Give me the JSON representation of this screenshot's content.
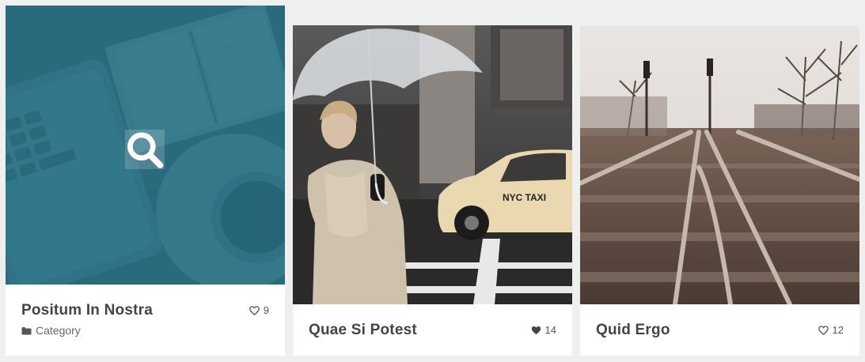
{
  "colors": {
    "page_background": "#efefef",
    "card_background": "#ffffff",
    "hover_overlay": "#2e6e80",
    "title_text": "#444444",
    "meta_text": "#666666"
  },
  "items": [
    {
      "title": "Positum In Nostra",
      "likes": "9",
      "liked": false,
      "category": "Category",
      "hovered": true,
      "image": "desk-laptop-notebook-coffee",
      "zoom_icon": "search-icon",
      "category_icon": "folder-icon",
      "like_icon": "heart-outline-icon"
    },
    {
      "title": "Quae Si Potest",
      "likes": "14",
      "liked": true,
      "image": "woman-umbrella-taxi-street",
      "like_icon": "heart-filled-icon"
    },
    {
      "title": "Quid Ergo",
      "likes": "12",
      "liked": false,
      "image": "railway-tracks",
      "like_icon": "heart-outline-icon"
    }
  ]
}
